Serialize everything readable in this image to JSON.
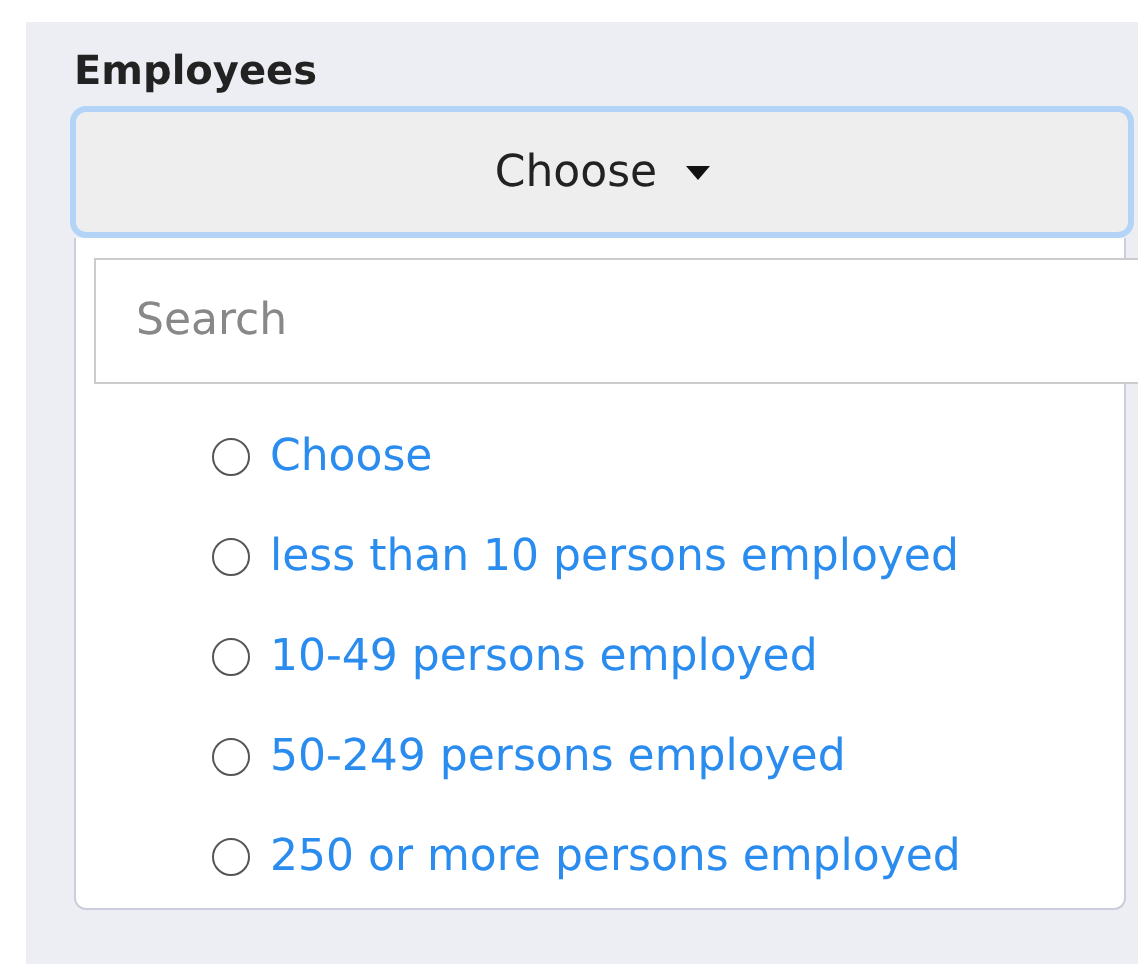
{
  "field": {
    "label": "Employees",
    "button": "Choose",
    "search": {
      "placeholder": "Search"
    },
    "options": [
      {
        "label": "Choose",
        "selected": false
      },
      {
        "label": "less than 10 persons employed",
        "selected": false
      },
      {
        "label": "10-49 persons employed",
        "selected": false
      },
      {
        "label": "50-249 persons employed",
        "selected": false
      },
      {
        "label": "250 or more persons employed",
        "selected": false
      }
    ]
  }
}
